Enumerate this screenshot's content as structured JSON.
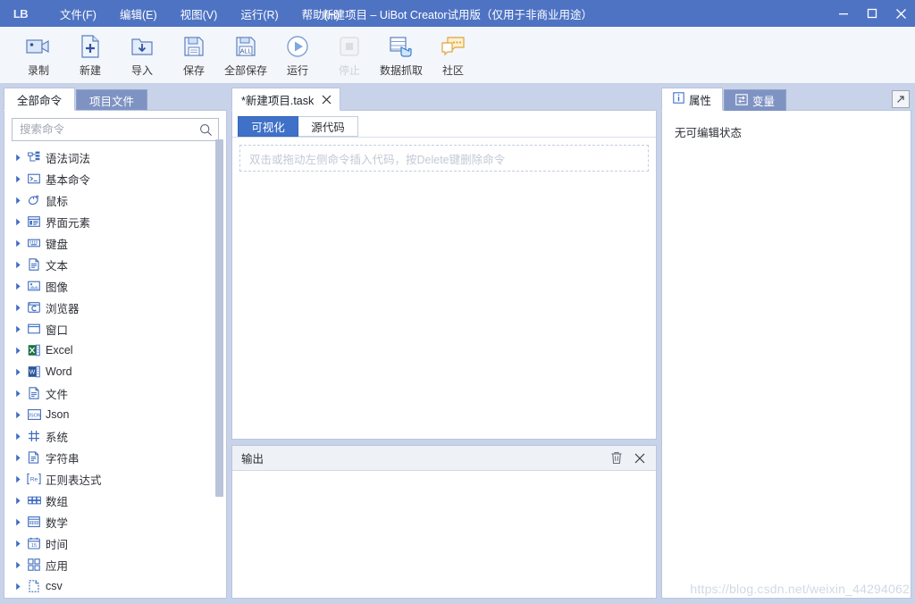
{
  "window": {
    "logo_text": "LB",
    "title": "新建项目 – UiBot Creator试用版（仅用于非商业用途）",
    "accent_color": "#4e73c3",
    "controls": [
      {
        "name": "minimize-button",
        "label": "最小化"
      },
      {
        "name": "maximize-button",
        "label": "最大化"
      },
      {
        "name": "close-button",
        "label": "关闭"
      }
    ]
  },
  "menubar": {
    "items": [
      {
        "label": "文件(F)",
        "name": "menu-file"
      },
      {
        "label": "编辑(E)",
        "name": "menu-edit"
      },
      {
        "label": "视图(V)",
        "name": "menu-view"
      },
      {
        "label": "运行(R)",
        "name": "menu-run"
      },
      {
        "label": "帮助(H)",
        "name": "menu-help"
      }
    ]
  },
  "toolbar": {
    "items": [
      {
        "label": "录制",
        "icon": "camera-icon",
        "disabled": false
      },
      {
        "label": "新建",
        "icon": "new-file-icon",
        "disabled": false
      },
      {
        "label": "导入",
        "icon": "import-folder-icon",
        "disabled": false
      },
      {
        "label": "保存",
        "icon": "save-icon",
        "disabled": false
      },
      {
        "label": "全部保存",
        "icon": "save-all-icon",
        "disabled": false
      },
      {
        "label": "运行",
        "icon": "play-icon",
        "disabled": false
      },
      {
        "label": "停止",
        "icon": "stop-icon",
        "disabled": true
      },
      {
        "label": "数据抓取",
        "icon": "data-scrape-icon",
        "disabled": false
      },
      {
        "label": "社区",
        "icon": "community-chat-icon",
        "disabled": false
      }
    ]
  },
  "left_panel": {
    "tabs": [
      {
        "label": "全部命令",
        "active": true
      },
      {
        "label": "项目文件",
        "active": false
      }
    ],
    "search": {
      "placeholder": "搜索命令",
      "value": ""
    },
    "tree_items": [
      {
        "label": "语法词法",
        "icon": "syntax-icon"
      },
      {
        "label": "基本命令",
        "icon": "console-icon"
      },
      {
        "label": "鼠标",
        "icon": "mouse-icon"
      },
      {
        "label": "界面元素",
        "icon": "ui-element-icon"
      },
      {
        "label": "键盘",
        "icon": "keyboard-icon"
      },
      {
        "label": "文本",
        "icon": "text-doc-icon"
      },
      {
        "label": "图像",
        "icon": "image-icon"
      },
      {
        "label": "浏览器",
        "icon": "browser-icon"
      },
      {
        "label": "窗口",
        "icon": "window-icon"
      },
      {
        "label": "Excel",
        "icon": "excel-icon"
      },
      {
        "label": "Word",
        "icon": "word-icon"
      },
      {
        "label": "文件",
        "icon": "file-icon"
      },
      {
        "label": "Json",
        "icon": "json-icon"
      },
      {
        "label": "系统",
        "icon": "system-icon"
      },
      {
        "label": "字符串",
        "icon": "string-icon"
      },
      {
        "label": "正则表达式",
        "icon": "regex-icon"
      },
      {
        "label": "数组",
        "icon": "array-icon"
      },
      {
        "label": "数学",
        "icon": "math-icon"
      },
      {
        "label": "时间",
        "icon": "calendar-icon"
      },
      {
        "label": "应用",
        "icon": "apps-icon"
      },
      {
        "label": "csv",
        "icon": "csv-icon"
      }
    ]
  },
  "editor": {
    "document_tab": {
      "label": "*新建项目.task",
      "close_label": "关闭标签"
    },
    "mode_tabs": [
      {
        "label": "可视化",
        "active": true
      },
      {
        "label": "源代码",
        "active": false
      }
    ],
    "drop_hint": "双击或拖动左侧命令插入代码，按Delete键删除命令"
  },
  "output": {
    "title": "输出",
    "clear_label": "清空",
    "close_label": "关闭",
    "content": ""
  },
  "right_panel": {
    "tabs": [
      {
        "label": "属性",
        "icon": "info-icon",
        "active": true
      },
      {
        "label": "变量",
        "icon": "variable-icon",
        "active": false
      }
    ],
    "expand_label": "展开",
    "empty_state": "无可编辑状态"
  },
  "watermark": "https://blog.csdn.net/weixin_44294062"
}
